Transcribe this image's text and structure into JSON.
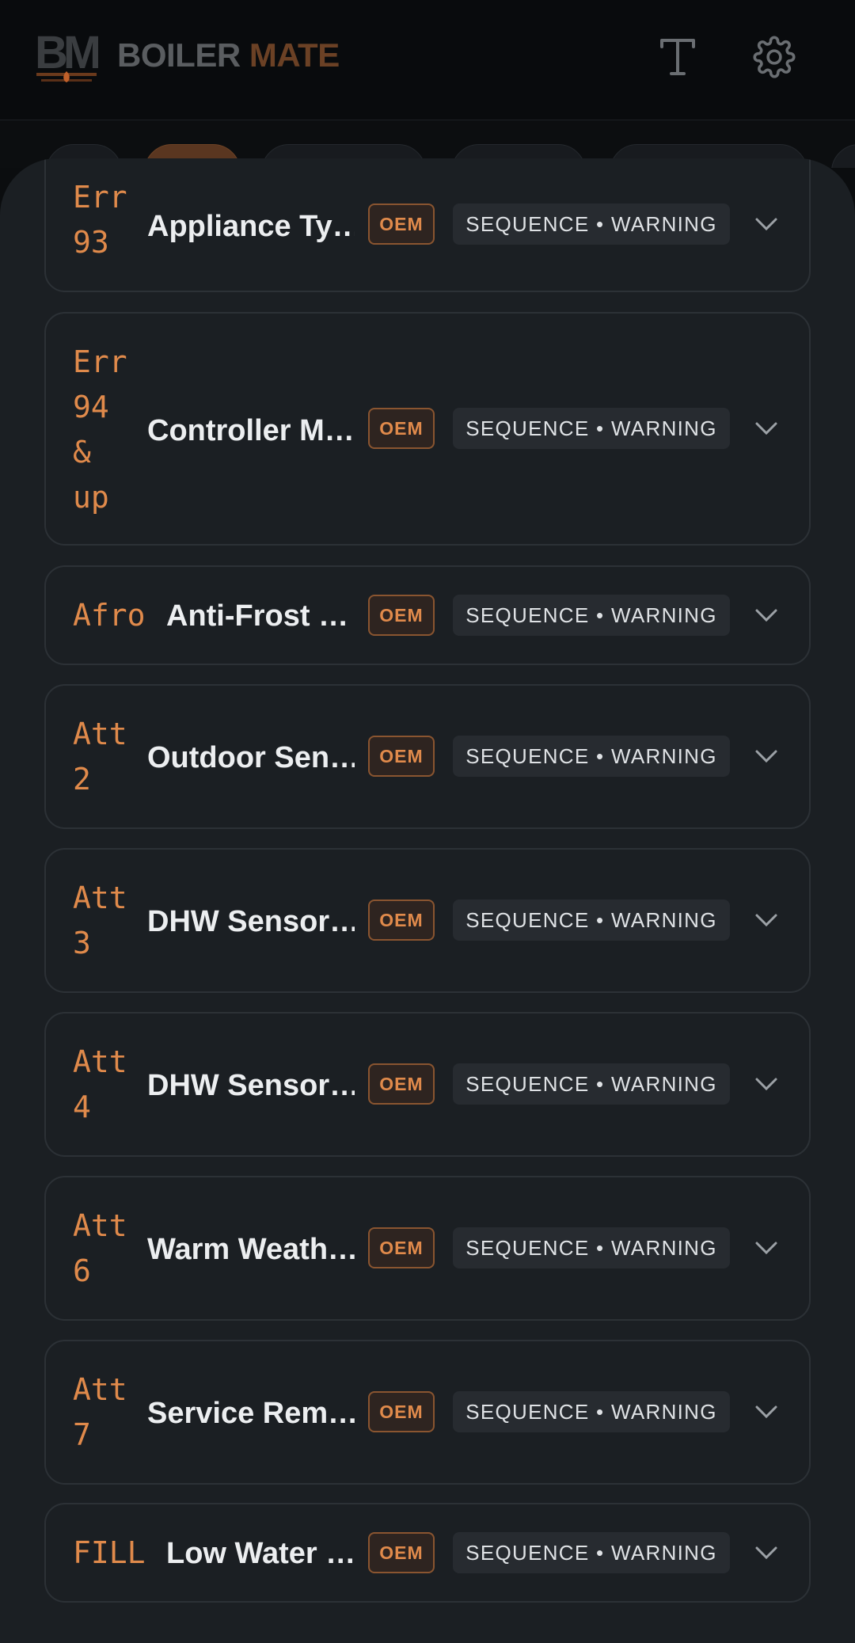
{
  "app": {
    "brand_part1": "BOILER",
    "brand_part2": "MATE",
    "logo_letters": "BM"
  },
  "header": {
    "font_icon": "font-size-icon",
    "settings_icon": "gear-icon"
  },
  "colors": {
    "accent": "#e08a4b",
    "card_bg": "#1b1f23",
    "header_bg": "#090b0d"
  },
  "cards": [
    {
      "code": "Err\n93",
      "title": "Appliance Ty…",
      "badge": "OEM",
      "tag": "SEQUENCE • WARNING"
    },
    {
      "code": "Err\n94\n&\nup",
      "title": "Controller M…",
      "badge": "OEM",
      "tag": "SEQUENCE • WARNING"
    },
    {
      "code": "Afro",
      "title": "Anti-Frost …",
      "badge": "OEM",
      "tag": "SEQUENCE • WARNING"
    },
    {
      "code": "Att\n2",
      "title": "Outdoor Sen…",
      "badge": "OEM",
      "tag": "SEQUENCE • WARNING"
    },
    {
      "code": "Att\n3",
      "title": "DHW Sensor…",
      "badge": "OEM",
      "tag": "SEQUENCE • WARNING"
    },
    {
      "code": "Att\n4",
      "title": "DHW Sensor…",
      "badge": "OEM",
      "tag": "SEQUENCE • WARNING"
    },
    {
      "code": "Att\n6",
      "title": "Warm Weath…",
      "badge": "OEM",
      "tag": "SEQUENCE • WARNING"
    },
    {
      "code": "Att\n7",
      "title": "Service Rem…",
      "badge": "OEM",
      "tag": "SEQUENCE • WARNING"
    },
    {
      "code": "FILL",
      "title": "Low Water …",
      "badge": "OEM",
      "tag": "SEQUENCE • WARNING"
    }
  ]
}
